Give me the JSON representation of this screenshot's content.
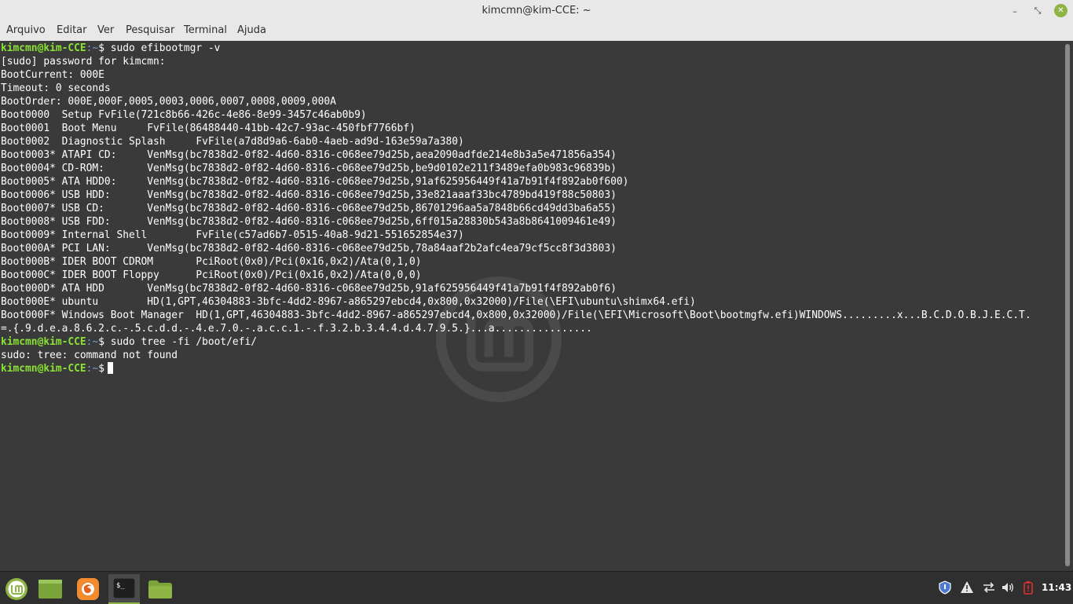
{
  "window": {
    "title": "kimcmn@kim-CCE: ~",
    "min_glyph": "–",
    "max_glyph": "⤡",
    "close_glyph": "✕"
  },
  "menu": [
    "Arquivo",
    "Editar",
    "Ver",
    "Pesquisar",
    "Terminal",
    "Ajuda"
  ],
  "prompt": {
    "user": "kimcmn@kim-CCE",
    "path": ":~",
    "symbol": "$"
  },
  "terminal": {
    "lines": [
      {
        "type": "prompt",
        "cmd": " sudo efibootmgr -v"
      },
      {
        "type": "out",
        "text": "[sudo] password for kimcmn:"
      },
      {
        "type": "out",
        "text": "BootCurrent: 000E"
      },
      {
        "type": "out",
        "text": "Timeout: 0 seconds"
      },
      {
        "type": "out",
        "text": "BootOrder: 000E,000F,0005,0003,0006,0007,0008,0009,000A"
      },
      {
        "type": "out",
        "text": "Boot0000  Setup FvFile(721c8b66-426c-4e86-8e99-3457c46ab0b9)"
      },
      {
        "type": "out",
        "text": "Boot0001  Boot Menu     FvFile(86488440-41bb-42c7-93ac-450fbf7766bf)"
      },
      {
        "type": "out",
        "text": "Boot0002  Diagnostic Splash     FvFile(a7d8d9a6-6ab0-4aeb-ad9d-163e59a7a380)"
      },
      {
        "type": "out",
        "text": "Boot0003* ATAPI CD:     VenMsg(bc7838d2-0f82-4d60-8316-c068ee79d25b,aea2090adfde214e8b3a5e471856a354)"
      },
      {
        "type": "out",
        "text": "Boot0004* CD-ROM:       VenMsg(bc7838d2-0f82-4d60-8316-c068ee79d25b,be9d0102e211f3489efa0b983c96839b)"
      },
      {
        "type": "out",
        "text": "Boot0005* ATA HDD0:     VenMsg(bc7838d2-0f82-4d60-8316-c068ee79d25b,91af625956449f41a7b91f4f892ab0f600)"
      },
      {
        "type": "out",
        "text": "Boot0006* USB HDD:      VenMsg(bc7838d2-0f82-4d60-8316-c068ee79d25b,33e821aaaf33bc4789bd419f88c50803)"
      },
      {
        "type": "out",
        "text": "Boot0007* USB CD:       VenMsg(bc7838d2-0f82-4d60-8316-c068ee79d25b,86701296aa5a7848b66cd49dd3ba6a55)"
      },
      {
        "type": "out",
        "text": "Boot0008* USB FDD:      VenMsg(bc7838d2-0f82-4d60-8316-c068ee79d25b,6ff015a28830b543a8b8641009461e49)"
      },
      {
        "type": "out",
        "text": "Boot0009* Internal Shell        FvFile(c57ad6b7-0515-40a8-9d21-551652854e37)"
      },
      {
        "type": "out",
        "text": "Boot000A* PCI LAN:      VenMsg(bc7838d2-0f82-4d60-8316-c068ee79d25b,78a84aaf2b2afc4ea79cf5cc8f3d3803)"
      },
      {
        "type": "out",
        "text": "Boot000B* IDER BOOT CDROM       PciRoot(0x0)/Pci(0x16,0x2)/Ata(0,1,0)"
      },
      {
        "type": "out",
        "text": "Boot000C* IDER BOOT Floppy      PciRoot(0x0)/Pci(0x16,0x2)/Ata(0,0,0)"
      },
      {
        "type": "out",
        "text": "Boot000D* ATA HDD       VenMsg(bc7838d2-0f82-4d60-8316-c068ee79d25b,91af625956449f41a7b91f4f892ab0f6)"
      },
      {
        "type": "out",
        "text": "Boot000E* ubuntu        HD(1,GPT,46304883-3bfc-4dd2-8967-a865297ebcd4,0x800,0x32000)/File(\\EFI\\ubuntu\\shimx64.efi)"
      },
      {
        "type": "out",
        "text": "Boot000F* Windows Boot Manager  HD(1,GPT,46304883-3bfc-4dd2-8967-a865297ebcd4,0x800,0x32000)/File(\\EFI\\Microsoft\\Boot\\bootmgfw.efi)WINDOWS.........x...B.C.D.O.B.J.E.C.T."
      },
      {
        "type": "out",
        "text": "=.{.9.d.e.a.8.6.2.c.-.5.c.d.d.-.4.e.7.0.-.a.c.c.1.-.f.3.2.b.3.4.4.d.4.7.9.5.}...a................"
      },
      {
        "type": "prompt",
        "cmd": " sudo tree -fi /boot/efi/"
      },
      {
        "type": "out",
        "text": "sudo: tree: command not found"
      },
      {
        "type": "prompt",
        "cmd": "",
        "cursor": true
      }
    ]
  },
  "taskbar": {
    "apps": [
      {
        "name": "mint-menu",
        "icon": "linux-mint-logo-icon"
      },
      {
        "name": "show-desktop",
        "icon": "desktop-icon"
      },
      {
        "name": "firefox",
        "icon": "firefox-icon"
      },
      {
        "name": "terminal",
        "icon": "terminal-icon",
        "active": true
      },
      {
        "name": "files",
        "icon": "folder-icon"
      }
    ],
    "tray": [
      "shield-icon",
      "warning-icon",
      "network-icon",
      "volume-icon",
      "battery-icon"
    ],
    "clock": "11:43",
    "accent": "#8fb446"
  }
}
